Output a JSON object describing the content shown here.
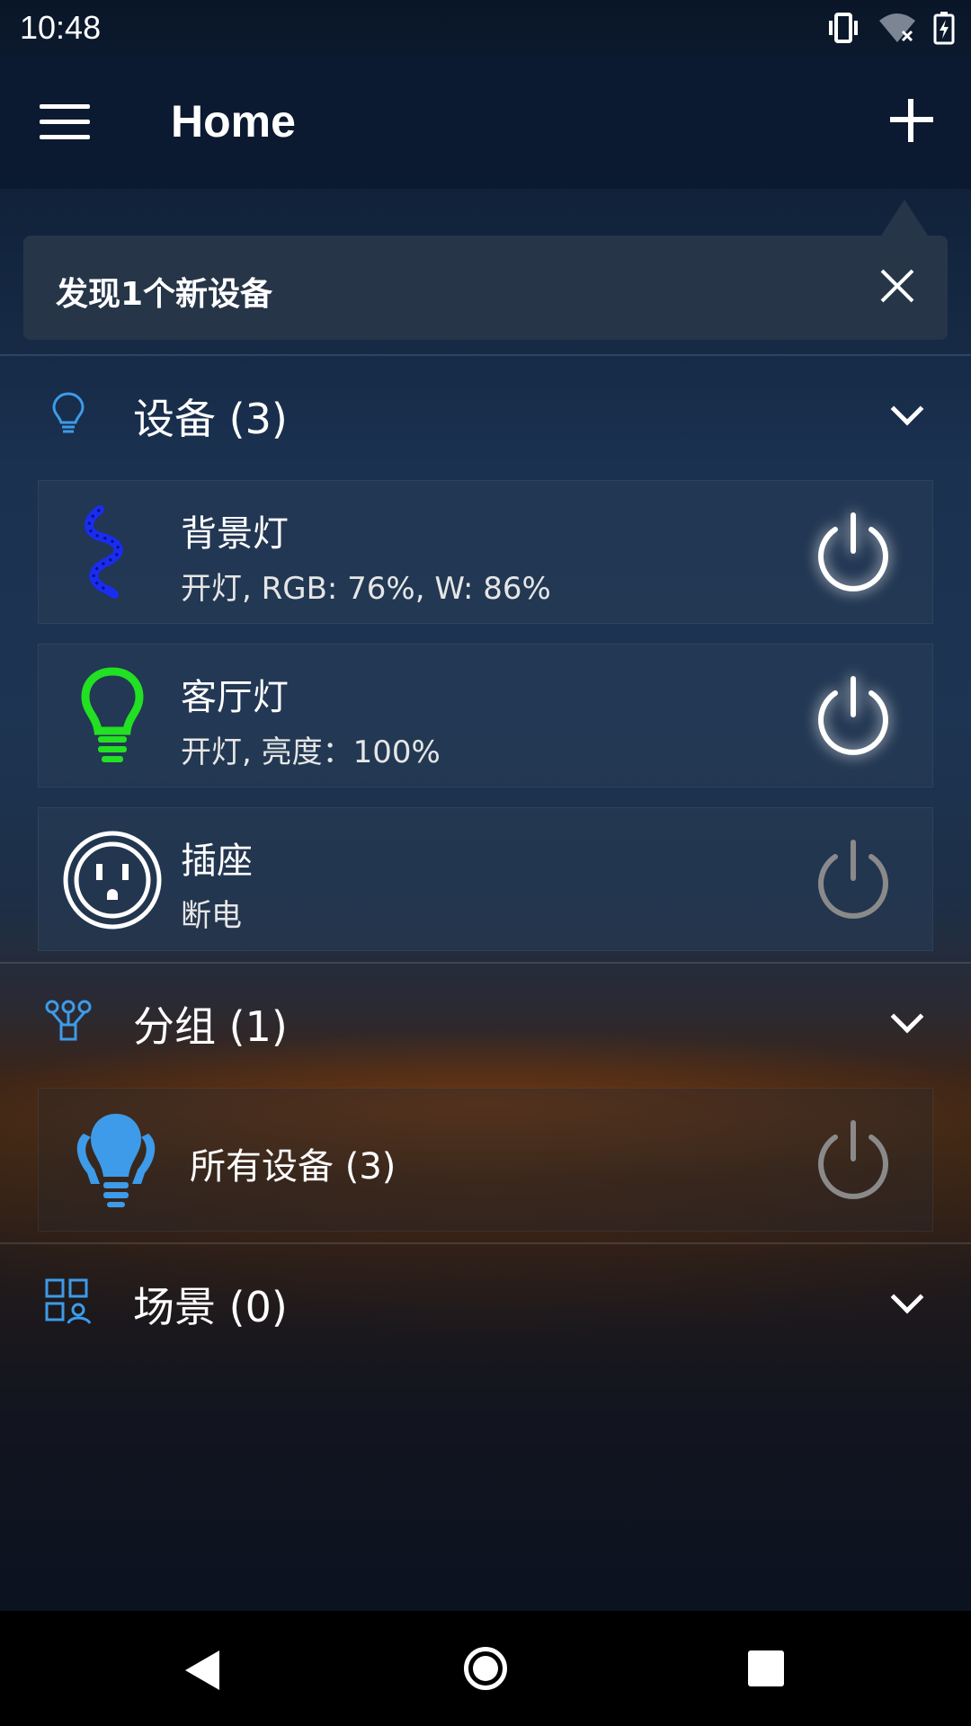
{
  "status_bar": {
    "time": "10:48",
    "icons": [
      "vibrate-icon",
      "wifi-off-icon",
      "battery-charging-icon"
    ]
  },
  "app_bar": {
    "title": "Home",
    "menu_icon": "menu-icon",
    "add_icon": "add-icon"
  },
  "banner": {
    "text": "发现1个新设备",
    "close_icon": "close-icon"
  },
  "sections": {
    "devices": {
      "title": "设备 (3)",
      "icon": "bulb-outline-icon",
      "items": [
        {
          "name": "背景灯",
          "status": "开灯, RGB: 76%, W: 86%",
          "icon": "led-strip-icon",
          "power": "on"
        },
        {
          "name": "客厅灯",
          "status": "开灯, 亮度：100%",
          "icon": "bulb-icon",
          "power": "on"
        },
        {
          "name": "插座",
          "status": "断电",
          "icon": "socket-icon",
          "power": "off"
        }
      ]
    },
    "groups": {
      "title": "分组 (1)",
      "icon": "group-icon",
      "items": [
        {
          "name": "所有设备 (3)",
          "icon": "bulb-group-icon",
          "power": "off"
        }
      ]
    },
    "scenes": {
      "title": "场景 (0)",
      "icon": "scene-icon"
    }
  },
  "colors": {
    "accent_blue": "#3d9be9",
    "strip_blue": "#1a2cf0",
    "bulb_green": "#22e022",
    "power_on": "#ffffff",
    "power_off": "#8a8a8a"
  }
}
